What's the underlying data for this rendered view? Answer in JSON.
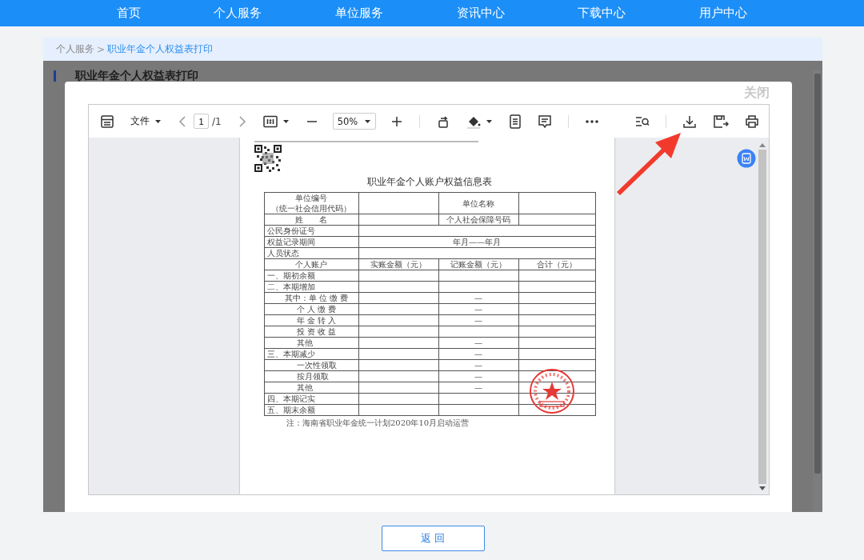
{
  "nav": [
    "首页",
    "个人服务",
    "单位服务",
    "资讯中心",
    "下载中心",
    "用户中心"
  ],
  "breadcrumb": {
    "items": [
      "个人服务",
      "职业年金个人权益表打印"
    ],
    "separator": ">"
  },
  "panel_title": "职业年金个人权益表打印",
  "modal": {
    "close_label": "关闭",
    "toolbar": {
      "file_menu": "文件",
      "page": "1",
      "page_total": "/1",
      "zoom": "50%"
    },
    "document": {
      "title": "职业年金个人账户权益信息表",
      "rows": [
        {
          "kind": "center",
          "label": "单位编号",
          "sublabel": "（统一社会信用代码）",
          "cells": [
            {},
            {
              "text": "单位名称"
            },
            {}
          ]
        },
        {
          "kind": "center",
          "label": "姓　　名",
          "cells": [
            {},
            {
              "text": "个人社会保障号码"
            },
            {}
          ]
        },
        {
          "kind": "wide",
          "label": "公民身份证号"
        },
        {
          "kind": "wide",
          "label": "权益记录期间",
          "value": "年月——年月"
        },
        {
          "kind": "wide",
          "label": "人员状态"
        },
        {
          "kind": "center",
          "label": "个人账户",
          "cells": [
            {
              "text": "实账金额（元）"
            },
            {
              "text": "记账金额（元）"
            },
            {
              "text": "合计（元）"
            }
          ]
        },
        {
          "kind": "left",
          "label": "一、期初余额",
          "cells": [
            {},
            {},
            {}
          ]
        },
        {
          "kind": "left",
          "label": "二、本期增加",
          "cells": [
            {},
            {},
            {}
          ]
        },
        {
          "kind": "right",
          "label": "其中：单 位 缴 费",
          "cells": [
            {},
            {
              "text": "—"
            },
            {}
          ]
        },
        {
          "kind": "sub",
          "label": "个 人 缴 费",
          "cells": [
            {},
            {
              "text": "—"
            },
            {}
          ]
        },
        {
          "kind": "sub",
          "label": "年 金 转 入",
          "cells": [
            {},
            {
              "text": "—"
            },
            {}
          ]
        },
        {
          "kind": "sub",
          "label": "投 资 收 益",
          "cells": [
            {},
            {},
            {}
          ]
        },
        {
          "kind": "sub",
          "label": "其他",
          "cells": [
            {},
            {
              "text": "—"
            },
            {}
          ]
        },
        {
          "kind": "left",
          "label": "三、本期减少",
          "cells": [
            {},
            {
              "text": "—"
            },
            {}
          ]
        },
        {
          "kind": "sub",
          "label": "一次性领取",
          "cells": [
            {},
            {
              "text": "—"
            },
            {}
          ]
        },
        {
          "kind": "sub",
          "label": "按月领取",
          "cells": [
            {},
            {
              "text": "—"
            },
            {}
          ]
        },
        {
          "kind": "sub",
          "label": "其他",
          "cells": [
            {},
            {
              "text": "—"
            },
            {}
          ]
        },
        {
          "kind": "left",
          "label": "四、本期记实",
          "cells": [
            {},
            {},
            {}
          ]
        },
        {
          "kind": "left",
          "label": "五、期末余额",
          "cells": [
            {},
            {},
            {}
          ]
        }
      ],
      "footnote": "注：海南省职业年金统一计划2020年10月启动运营"
    }
  },
  "back_button": "返 回"
}
